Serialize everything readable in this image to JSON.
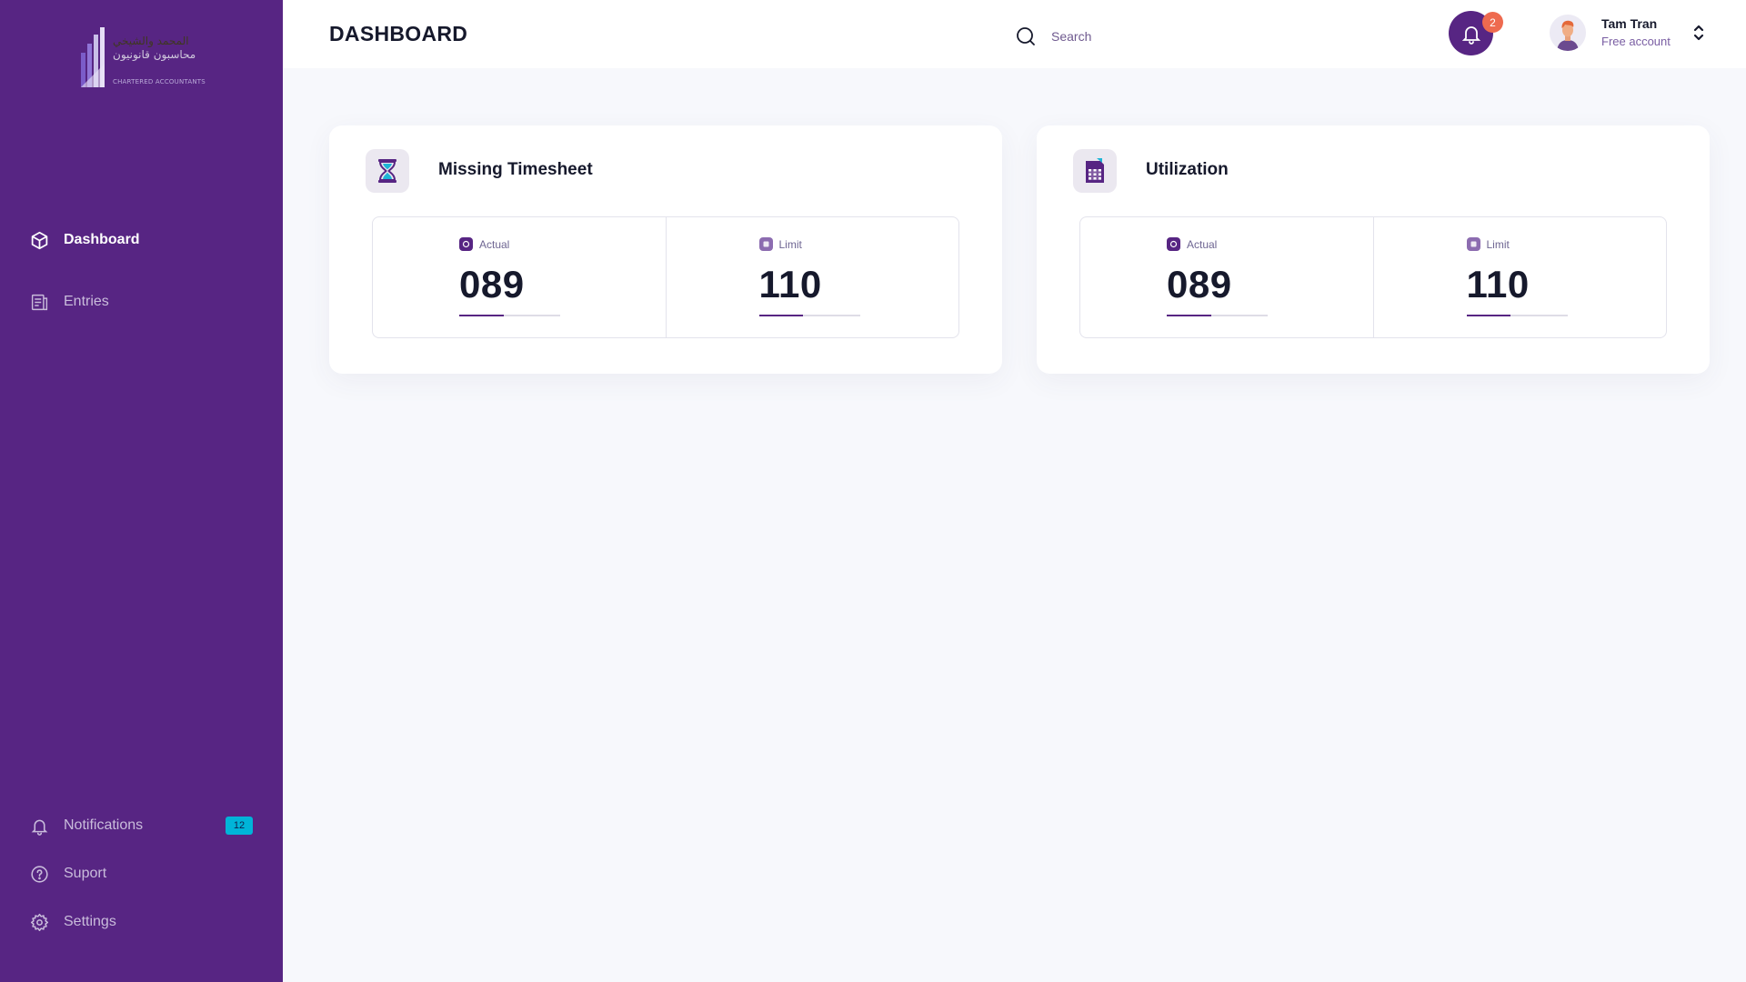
{
  "brand": {
    "logo_line_1": "المحمد والشيخي",
    "logo_line_2": "محاسبون قانونيون",
    "logo_line_3": "CHARTERED ACCOUNTANTS",
    "accent_color": "#572583"
  },
  "sidebar": {
    "top_items": [
      {
        "label": "Dashboard",
        "icon": "cube-icon",
        "active": true
      },
      {
        "label": "Entries",
        "icon": "document-icon",
        "active": false
      }
    ],
    "bottom_items": [
      {
        "label": "Notifications",
        "icon": "bell-icon",
        "badge": "12"
      },
      {
        "label": "Suport",
        "icon": "help-circle-icon"
      },
      {
        "label": "Settings",
        "icon": "gear-icon"
      }
    ]
  },
  "header": {
    "title": "DASHBOARD",
    "search_placeholder": "Search",
    "notification_count": "2",
    "user": {
      "name": "Tam Tran",
      "plan": "Free account"
    }
  },
  "cards": [
    {
      "title": "Missing Timesheet",
      "icon": "hourglass-icon",
      "actual": {
        "label": "Actual",
        "value": "089",
        "progress": 0.44
      },
      "limit": {
        "label": "Limit",
        "value": "110",
        "progress": 0.44
      }
    },
    {
      "title": "Utilization",
      "icon": "calculator-icon",
      "actual": {
        "label": "Actual",
        "value": "089",
        "progress": 0.44
      },
      "limit": {
        "label": "Limit",
        "value": "110",
        "progress": 0.44
      }
    }
  ]
}
